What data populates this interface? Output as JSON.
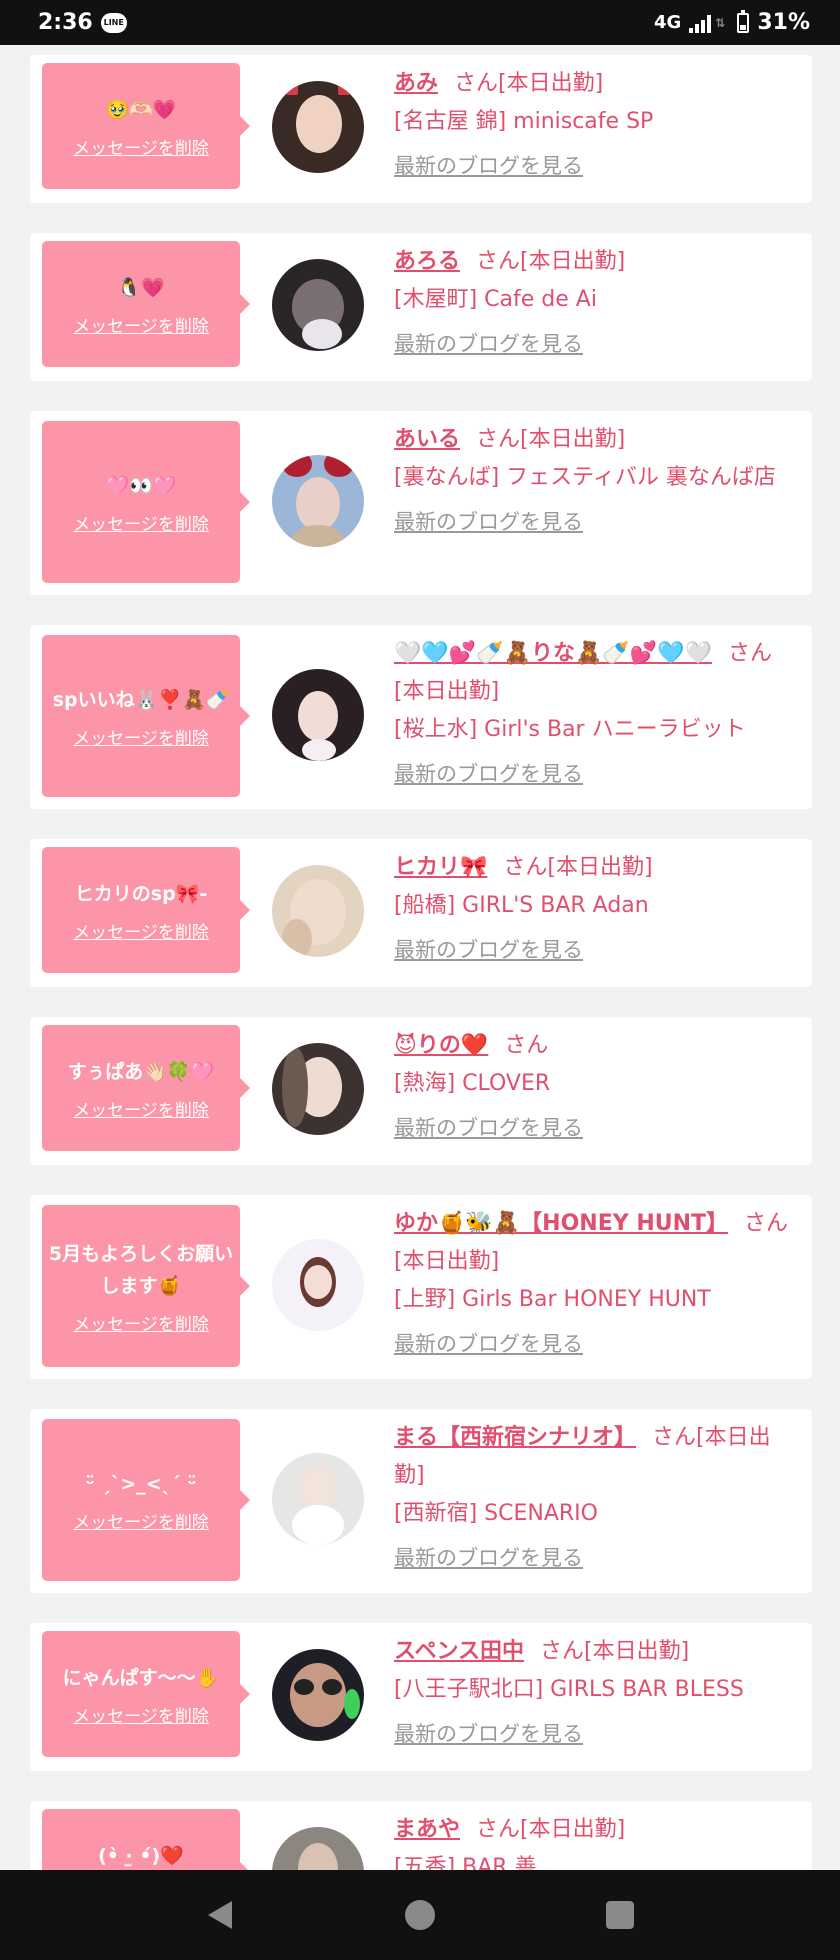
{
  "status_bar": {
    "time": "2:36",
    "line_label": "LINE",
    "network": "4G",
    "battery": "31%"
  },
  "labels": {
    "delete_message": "メッセージを削除",
    "latest_blog": "最新のブログを見る"
  },
  "entries": [
    {
      "message": "🥹🫶🏻💗",
      "name": "あみ",
      "suffix": "さん[本日出勤]",
      "shop": "[名古屋 錦] miniscafe SP"
    },
    {
      "message": "🐧💗",
      "name": "あろる",
      "suffix": "さん[本日出勤]",
      "shop": "[木屋町] Cafe de Ai"
    },
    {
      "message": "🩷👀🩷",
      "name": "あいる",
      "suffix": "さん[本日出勤]",
      "shop": "[裏なんば] フェスティバル 裏なんば店"
    },
    {
      "message": "spいいね🐰❣️🧸🍼",
      "name": "🤍🩵💕🍼🧸りな🧸🍼💕🩵🤍",
      "suffix": "さん[本日出勤]",
      "shop": "[桜上水] Girl's Bar ハニーラビット"
    },
    {
      "message": "ヒカリのsp🎀-",
      "name": "ヒカリ🎀",
      "suffix": "さん[本日出勤]",
      "shop": "[船橋] GIRL'S BAR Adan"
    },
    {
      "message": "すぅぱあ👋🏻🍀🩷",
      "name": "😈りの❤️",
      "suffix": "さん",
      "shop": "[熱海] CLOVER"
    },
    {
      "message": "5月もよろしくお願いします🍯",
      "name": "ゆか🍯🐝🧸【HONEY HUNT】",
      "suffix": "さん[本日出勤]",
      "shop": "[上野] Girls Bar HONEY HUNT"
    },
    {
      "message": "ᵕ̈ ˏˋ>_<ˎˊ ᵕ̈",
      "name": "まる【西新宿シナリオ】",
      "suffix": "さん[本日出勤]",
      "shop": "[西新宿] SCENARIO"
    },
    {
      "message": "にゃんぱす〜〜✋",
      "name": "スペンス田中",
      "suffix": "さん[本日出勤]",
      "shop": "[八王子駅北口] GIRLS BAR BLESS"
    },
    {
      "message": "(•̀ ·̫ •́)❤️",
      "name": "まあや",
      "suffix": "さん[本日出勤]",
      "shop": "[五香] BAR 善"
    }
  ],
  "nav": {
    "back": "back-icon",
    "home": "home-icon",
    "recents": "recents-icon"
  },
  "colors": {
    "accent": "#e0506e",
    "bubble": "#fd95a8",
    "muted_link": "#999999"
  }
}
